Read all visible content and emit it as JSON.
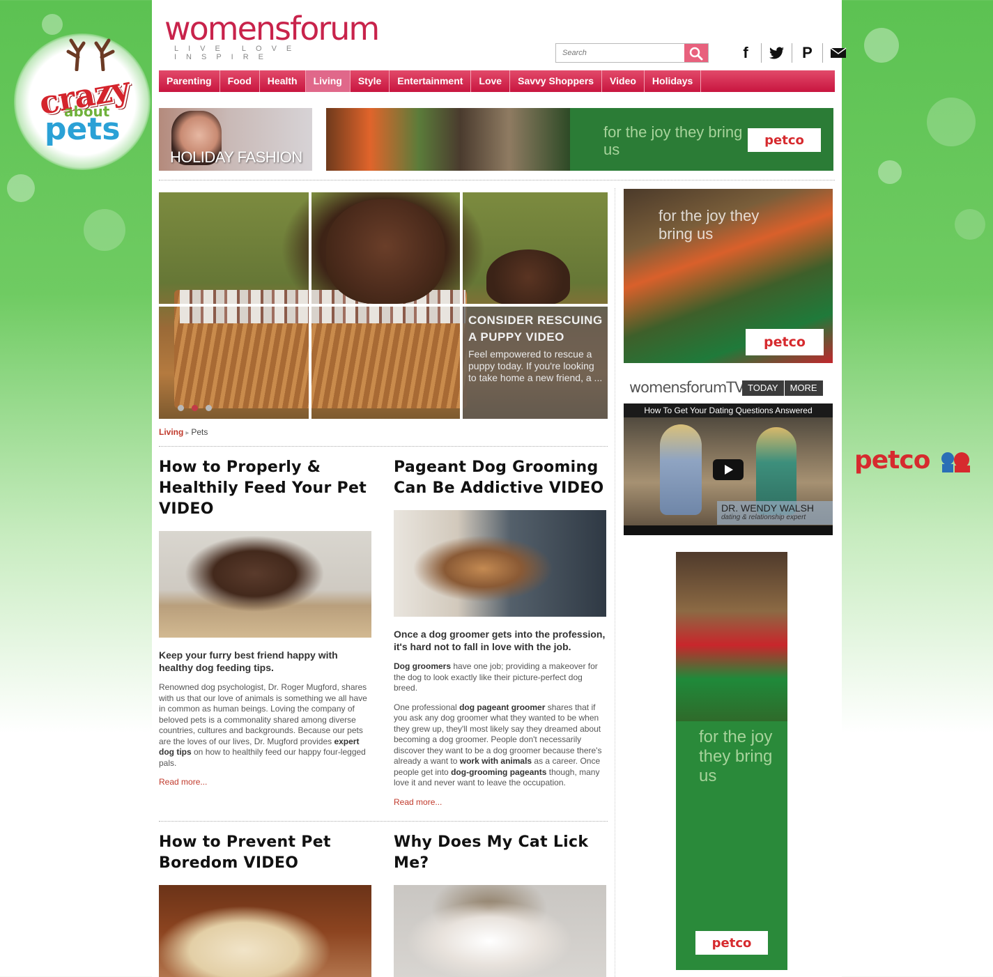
{
  "side_brand": {
    "crazy": "crazy",
    "about": "about",
    "pets": "pets",
    "petco_right": "petco"
  },
  "header": {
    "logo": {
      "text_main": "womensforum",
      "tagline": "LIVE LOVE INSPIRE"
    },
    "search": {
      "placeholder": "Search"
    },
    "social": [
      {
        "icon": "facebook-icon",
        "glyph": "f"
      },
      {
        "icon": "twitter-icon",
        "glyph": "🐦"
      },
      {
        "icon": "pinterest-icon",
        "glyph": "P"
      },
      {
        "icon": "mail-icon",
        "glyph": "✉"
      }
    ]
  },
  "nav": {
    "items": [
      {
        "label": "Parenting",
        "active": false
      },
      {
        "label": "Food",
        "active": false
      },
      {
        "label": "Health",
        "active": false
      },
      {
        "label": "Living",
        "active": true
      },
      {
        "label": "Style",
        "active": false
      },
      {
        "label": "Entertainment",
        "active": false
      },
      {
        "label": "Love",
        "active": false
      },
      {
        "label": "Savvy Shoppers",
        "active": false
      },
      {
        "label": "Video",
        "active": false
      },
      {
        "label": "Holidays",
        "active": false
      }
    ]
  },
  "promos": {
    "fashion_label": "HOLIDAY FASHION",
    "banner_tagline": "for the joy they bring us",
    "banner_brand": "petco"
  },
  "hero": {
    "title": "CONSIDER RESCUING A PUPPY VIDEO",
    "description": "Feel empowered to rescue a puppy today. If you're looking to take home a new friend, a ...",
    "slide_count": 3,
    "active_slide": 2
  },
  "breadcrumb": {
    "section": "Living",
    "current": "Pets"
  },
  "articles": [
    {
      "title": "How to Properly & Healthily Feed Your Pet VIDEO",
      "lead": "Keep your furry best friend happy with healthy dog feeding tips.",
      "body": [
        {
          "text": "Renowned dog psychologist, Dr. Roger Mugford, shares with us that our love of animals is something we all have in common as human beings. Loving the company of beloved pets is a commonality shared among diverse countries, cultures and backgrounds. Because our pets are the loves of our lives, Dr. Mugford provides "
        },
        {
          "bold": "expert dog tips"
        },
        {
          "text": " on how to healthily feed our happy four-legged pals."
        }
      ],
      "more": "Read more..."
    },
    {
      "title": "Pageant Dog Grooming Can Be Addictive VIDEO",
      "lead": "Once a dog groomer gets into the profession, it's hard not to fall in love with the job.",
      "body1": [
        {
          "bold": "Dog groomers"
        },
        {
          "text": " have one job; providing a makeover for the dog to look exactly like their picture-perfect dog breed."
        }
      ],
      "body2": [
        {
          "text": "One professional "
        },
        {
          "bold": "dog pageant groomer"
        },
        {
          "text": " shares that if you ask any dog groomer what they wanted to be when they grew up, they'll most likely say they dreamed about becoming a dog groomer. People don't necessarily discover they want to be a dog groomer because there's already a want to "
        },
        {
          "bold": "work with animals"
        },
        {
          "text": " as a career. Once people get into "
        },
        {
          "bold": "dog-grooming pageants"
        },
        {
          "text": " though, many love it and never want to leave the occupation."
        }
      ],
      "more": "Read more..."
    },
    {
      "title": "How to Prevent Pet Boredom VIDEO"
    },
    {
      "title": "Why Does My Cat Lick Me?"
    }
  ],
  "sidebar": {
    "ad1": {
      "tagline": "for the joy they bring us",
      "brand": "petco"
    },
    "tv": {
      "brand": "womensforumTV",
      "tabs": [
        "TODAY",
        "MORE"
      ],
      "video_title": "How To Get Your Dating Questions Answered",
      "lower_third_name": "DR. WENDY WALSH",
      "lower_third_role": "dating & relationship expert"
    },
    "ad2": {
      "tagline": "for the joy they bring us",
      "brand": "petco"
    }
  },
  "colors": {
    "brand_pink": "#c8234b",
    "nav_red": "#c8153f",
    "link_red": "#c0392b",
    "green_bg": "#5cc252",
    "petco_red": "#d62a2e"
  }
}
